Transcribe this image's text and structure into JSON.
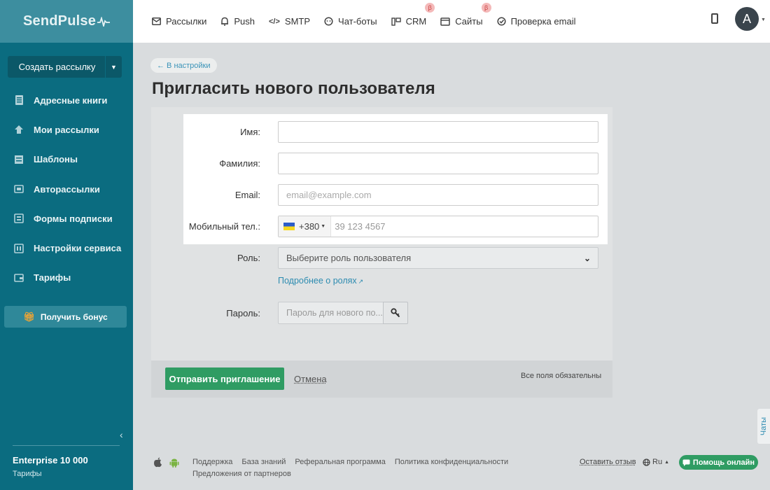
{
  "brand": {
    "logo_text": "SendPulse"
  },
  "sidebar": {
    "create_button": "Создать рассылку",
    "items": [
      {
        "label": "Адресные книги",
        "icon": "address-book-icon"
      },
      {
        "label": "Мои рассылки",
        "icon": "campaigns-icon"
      },
      {
        "label": "Шаблоны",
        "icon": "templates-icon"
      },
      {
        "label": "Авторассылки",
        "icon": "automation-icon"
      },
      {
        "label": "Формы подписки",
        "icon": "forms-icon"
      },
      {
        "label": "Настройки сервиса",
        "icon": "settings-icon"
      },
      {
        "label": "Тарифы",
        "icon": "wallet-icon"
      }
    ],
    "bonus": "Получить бонус",
    "plan_name": "Enterprise 10 000",
    "plan_link": "Тарифы"
  },
  "topnav": {
    "items": [
      {
        "label": "Рассылки",
        "icon": "mail-icon"
      },
      {
        "label": "Push",
        "icon": "bell-icon"
      },
      {
        "label": "SMTP",
        "icon": "code-icon"
      },
      {
        "label": "Чат-боты",
        "icon": "chatbot-icon"
      },
      {
        "label": "CRM",
        "icon": "crm-icon",
        "beta": "β"
      },
      {
        "label": "Сайты",
        "icon": "sites-icon",
        "beta": "β"
      },
      {
        "label": "Проверка email",
        "icon": "check-icon"
      }
    ],
    "avatar_letter": "A"
  },
  "page": {
    "back": "← В настройки",
    "title": "Пригласить нового пользователя"
  },
  "form": {
    "first_name": {
      "label": "Имя:",
      "value": ""
    },
    "last_name": {
      "label": "Фамилия:",
      "value": ""
    },
    "email": {
      "label": "Email:",
      "placeholder": "email@example.com"
    },
    "phone": {
      "label": "Мобильный тел.:",
      "code": "+380",
      "placeholder": "39 123 4567"
    },
    "role": {
      "label": "Роль:",
      "selected": "Выберите роль пользователя"
    },
    "roles_link": "Подробнее о ролях",
    "password": {
      "label": "Пароль:",
      "placeholder": "Пароль для нового по..."
    },
    "submit": "Отправить приглашение",
    "cancel": "Отмена",
    "required_note": "Все поля обязательны"
  },
  "footer": {
    "links": [
      "Поддержка",
      "База знаний",
      "Реферальная программа",
      "Политика конфиденциальности"
    ],
    "partners": "Предложения от партнеров",
    "feedback": "Оставить отзыв",
    "language": "Ru",
    "help": "Помощь онлайн",
    "chats_tab": "Чаты"
  },
  "colors": {
    "sidebar": "#0b6c80",
    "accent_green": "#2f9c63",
    "link_blue": "#2c8bb0",
    "beta_badge": "#f4b9b9"
  }
}
